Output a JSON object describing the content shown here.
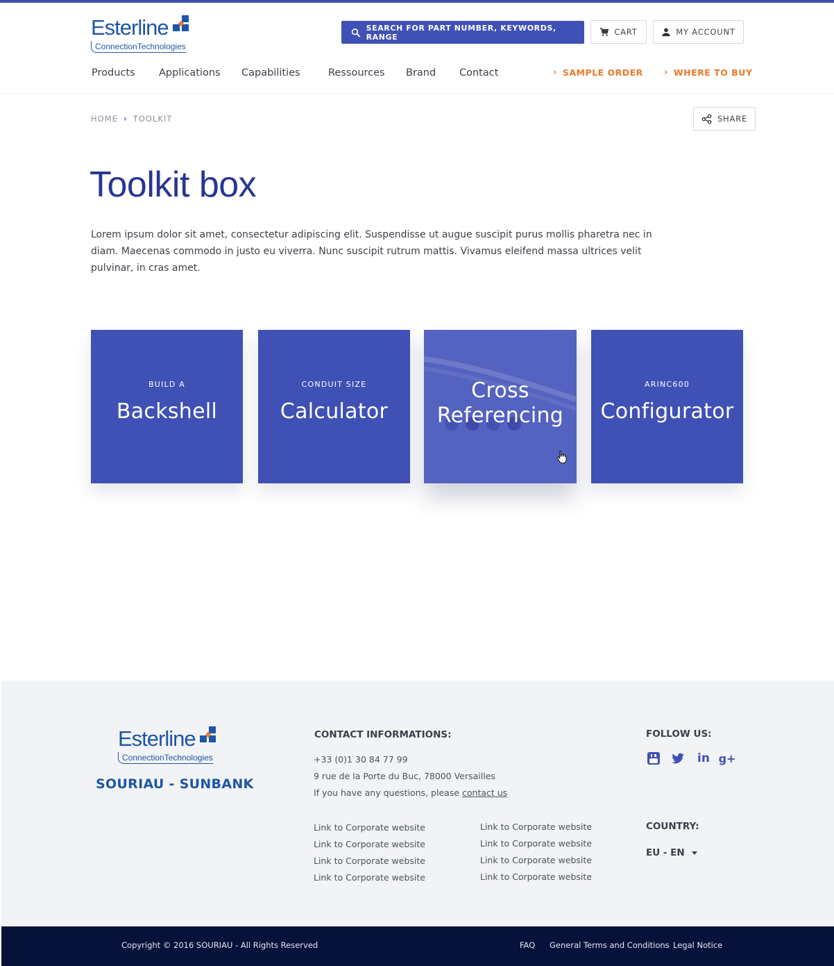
{
  "brand": {
    "logo_word": "Esterline",
    "logo_sub": "ConnectionTechnologies",
    "footer_brand": "SOURIAU - SUNBANK"
  },
  "header": {
    "search_label": "SEARCH FOR PART NUMBER, KEYWORDS, RANGE",
    "cart_label": "CART",
    "account_label": "MY ACCOUNT"
  },
  "nav": {
    "items": [
      "Products",
      "Applications",
      "Capabilities",
      "Ressources",
      "Brand",
      "Contact"
    ],
    "sample_order": "SAMPLE ORDER",
    "where_to_buy": "WHERE TO BUY"
  },
  "breadcrumb": {
    "home": "HOME",
    "current": "TOOLKIT"
  },
  "share_label": "SHARE",
  "page": {
    "title": "Toolkit box",
    "intro": "Lorem ipsum dolor sit amet, consectetur adipiscing elit. Suspendisse ut augue suscipit purus mollis pharetra nec in diam. Maecenas commodo in justo eu viverra. Nunc suscipit rutrum mattis. Vivamus eleifend massa ultrices velit pulvinar, in cras amet."
  },
  "tools": [
    {
      "kicker": "BUILD A",
      "name": "Backshell"
    },
    {
      "kicker": "CONDUIT SIZE",
      "name": "Calculator"
    },
    {
      "kicker": "",
      "name": "Cross Referencing",
      "name_line1": "Cross",
      "name_line2": "Referencing"
    },
    {
      "kicker": "ARINC600",
      "name": "Configurator"
    }
  ],
  "footer": {
    "contact_heading": "CONTACT INFORMATIONS:",
    "phone": "+33 (0)1 30 84 77 99",
    "address": "9 rue de la Porte du Buc, 78000 Versailles",
    "questions_text": "If you have any questions, please ",
    "contact_link": "contact us",
    "links_col1": [
      "Link to Corporate website",
      "Link to Corporate website",
      "Link to Corporate website",
      "Link to Corporate website"
    ],
    "links_col2": [
      "Link to Corporate website",
      "Link to Corporate website",
      "Link to Corporate website",
      "Link to Corporate website"
    ],
    "follow_heading": "FOLLOW US:",
    "social_icons": [
      "youtube-icon",
      "twitter-icon",
      "linkedin-icon",
      "google-plus-icon"
    ],
    "country_heading": "COUNTRY:",
    "country_value": "EU - EN"
  },
  "bottom": {
    "copyright": "Copyright © 2016 SOURIAU - All Rights Reserved",
    "faq": "FAQ",
    "terms": "General Terms and Conditions",
    "legal": "Legal Notice"
  },
  "colors": {
    "primary": "#3f51b5",
    "title": "#283593",
    "accent_orange": "#f0782a",
    "logo_blue": "#1e56a5",
    "footer_bg": "#f2f3f5",
    "bottom_bar": "#06123a"
  }
}
